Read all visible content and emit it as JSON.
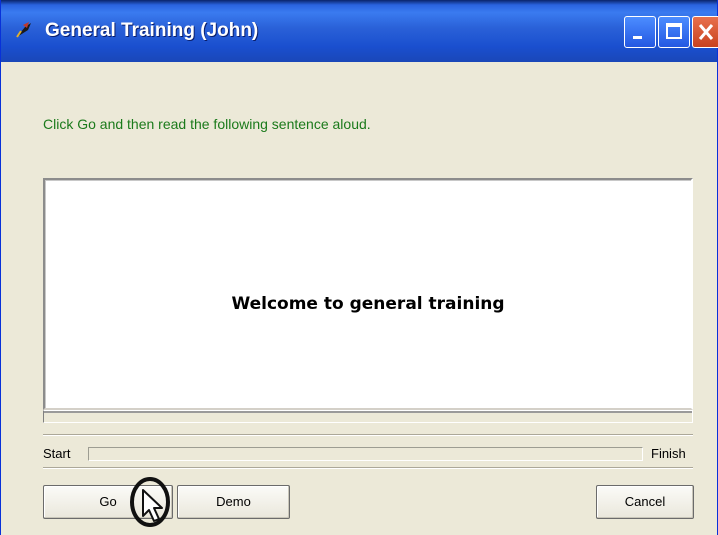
{
  "window": {
    "title": "General Training (John)",
    "icon": "training-app-icon",
    "controls": {
      "minimize": "minimize-icon",
      "maximize": "maximize-icon",
      "close": "close-icon"
    }
  },
  "instruction": "Click Go and then read the following sentence aloud.",
  "sentence": "Welcome to general training",
  "progress": {
    "start_label": "Start",
    "finish_label": "Finish",
    "value_percent": 0
  },
  "buttons": {
    "go": "Go",
    "demo": "Demo",
    "cancel": "Cancel"
  },
  "colors": {
    "instruction_text": "#1b7a1b",
    "titlebar": "#2a61d8",
    "window_bg": "#ece9d8"
  }
}
